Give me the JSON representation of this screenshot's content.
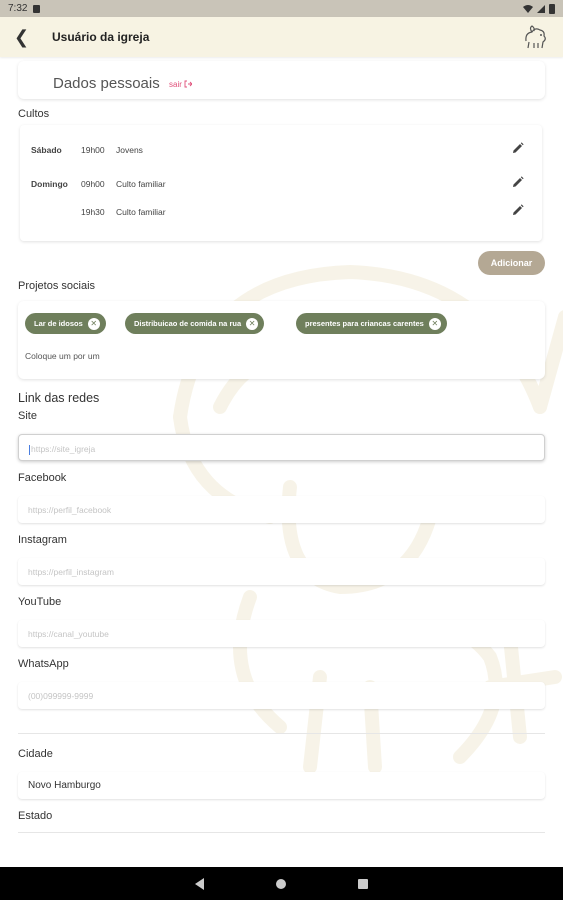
{
  "statusbar": {
    "time": "7:32"
  },
  "appbar": {
    "title": "Usuário da igreja"
  },
  "personal": {
    "title": "Dados pessoais",
    "logout": "sair"
  },
  "cultos": {
    "label": "Cultos",
    "rows": [
      {
        "day": "Sábado",
        "time": "19h00",
        "desc": "Jovens"
      },
      {
        "day": "Domingo",
        "time": "09h00",
        "desc": "Culto familiar"
      },
      {
        "day": "",
        "time": "19h30",
        "desc": "Culto familiar"
      }
    ],
    "add_label": "Adicionar"
  },
  "projetos": {
    "label": "Projetos sociais",
    "chips": [
      "Lar de idosos",
      "Distribuicao de comida na rua",
      "presentes para criancas carentes"
    ],
    "placeholder": "Coloque um por um"
  },
  "links": {
    "section_title": "Link das redes",
    "fields": [
      {
        "label": "Site",
        "placeholder": "https://site_igreja"
      },
      {
        "label": "Facebook",
        "placeholder": "https://perfil_facebook"
      },
      {
        "label": "Instagram",
        "placeholder": "https://perfil_instagram"
      },
      {
        "label": "YouTube",
        "placeholder": "https://canal_youtube"
      },
      {
        "label": "WhatsApp",
        "placeholder": "(00)099999-9999"
      }
    ]
  },
  "cidade": {
    "label": "Cidade",
    "value": "Novo Hamburgo"
  },
  "estado": {
    "label": "Estado",
    "value": ""
  },
  "colors": {
    "appbar_bg": "#f7f3e3",
    "chip_bg": "#6f7f5c",
    "add_button_bg": "#b4a894",
    "logout_color": "#e0507a"
  }
}
